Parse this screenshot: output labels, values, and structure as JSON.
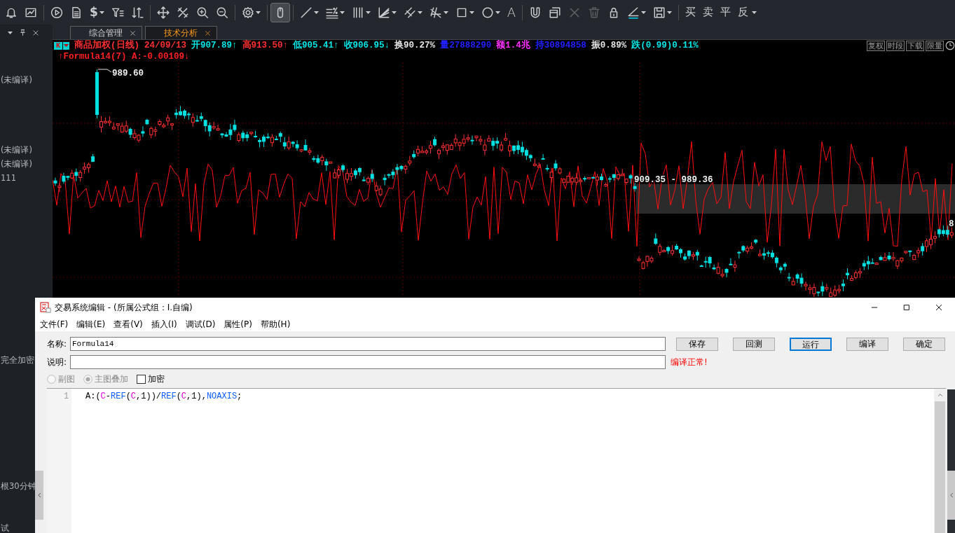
{
  "toolbar": {
    "tools": [
      {
        "selected": false,
        "dropdown": false,
        "disabled": false
      },
      {
        "selected": false,
        "dropdown": false,
        "disabled": false
      },
      {
        "selected": false,
        "dropdown": false,
        "disabled": false
      },
      {
        "selected": false,
        "dropdown": false,
        "disabled": false
      },
      {
        "glyph": "$",
        "selected": false,
        "dropdown": true,
        "disabled": false
      },
      {
        "selected": false,
        "dropdown": false,
        "disabled": false
      },
      {
        "selected": false,
        "dropdown": false,
        "disabled": false
      },
      {
        "selected": false,
        "dropdown": false,
        "disabled": false
      },
      {
        "selected": false,
        "dropdown": false,
        "disabled": false
      },
      {
        "selected": false,
        "dropdown": false,
        "disabled": false
      },
      {
        "selected": false,
        "dropdown": false,
        "disabled": false
      },
      {
        "selected": false,
        "dropdown": true,
        "disabled": false
      },
      {
        "selected": true,
        "dropdown": false,
        "disabled": false
      },
      {
        "selected": false,
        "dropdown": true,
        "disabled": false
      },
      {
        "selected": false,
        "dropdown": true,
        "disabled": false
      },
      {
        "selected": false,
        "dropdown": true,
        "disabled": false
      },
      {
        "selected": false,
        "dropdown": true,
        "disabled": false
      },
      {
        "selected": false,
        "dropdown": true,
        "disabled": false
      },
      {
        "selected": false,
        "dropdown": true,
        "disabled": false
      },
      {
        "selected": false,
        "dropdown": true,
        "disabled": false
      },
      {
        "selected": false,
        "dropdown": true,
        "disabled": false
      },
      {
        "glyph": "A",
        "selected": false,
        "dropdown": false,
        "disabled": false
      },
      {
        "selected": false,
        "dropdown": false,
        "disabled": false
      },
      {
        "selected": false,
        "dropdown": false,
        "disabled": false
      },
      {
        "selected": false,
        "dropdown": false,
        "disabled": true
      },
      {
        "selected": false,
        "dropdown": false,
        "disabled": true
      },
      {
        "selected": false,
        "dropdown": false,
        "disabled": false
      },
      {
        "selected": false,
        "dropdown": true,
        "disabled": false
      },
      {
        "selected": false,
        "dropdown": true,
        "disabled": false
      }
    ],
    "trade_buttons": [
      "买",
      "卖",
      "平",
      "反"
    ]
  },
  "left_panel": {
    "items": [
      "(未编译)",
      "(未编译)",
      "(未编译)",
      "111",
      "完全加密",
      "根30分钟",
      "试"
    ]
  },
  "tabs": [
    {
      "label": "综合管理",
      "selected": false
    },
    {
      "label": "技术分析",
      "selected": true
    }
  ],
  "chart": {
    "badge": "K",
    "quote": [
      {
        "text": "商品加权(日线)",
        "color": "#ff3030"
      },
      {
        "text": "24/09/13",
        "color": "#ff3030"
      },
      {
        "text": "开907.89↑",
        "color": "#00e5e5"
      },
      {
        "text": "高913.50↑",
        "color": "#ff3030"
      },
      {
        "text": "低905.41↑",
        "color": "#00e5e5"
      },
      {
        "text": "收906.95↓",
        "color": "#00e5e5"
      },
      {
        "text": "换90.27%",
        "color": "#e6e6e6"
      },
      {
        "text": "量27888290",
        "color": "#2020ff"
      },
      {
        "text": "额1.4兆",
        "color": "#ff30ff"
      },
      {
        "text": "持30894858",
        "color": "#2020ff"
      },
      {
        "text": "振0.89%",
        "color": "#e6e6e6"
      },
      {
        "text": "跌(0.99)0.11%",
        "color": "#00e5e5"
      }
    ],
    "indicator": "↑Formula14(7) A:-0.00109↓",
    "side_buttons": [
      "复权",
      "时段",
      "下载",
      "限量"
    ],
    "peak_label": "989.60",
    "range_label": "909.35 - 989.36",
    "edge_label": "8"
  },
  "dialog": {
    "title": "交易系统编辑 - (所属公式组：I.自编)",
    "menu": [
      "文件(F)",
      "编辑(E)",
      "查看(V)",
      "插入(I)",
      "调试(D)",
      "属性(P)",
      "帮助(H)"
    ],
    "name_label": "名称:",
    "name_value": "Formula14",
    "desc_label": "说明:",
    "buttons": [
      {
        "label": "保存",
        "focused": false
      },
      {
        "label": "回测",
        "focused": false
      },
      {
        "label": "运行",
        "focused": true
      },
      {
        "label": "编译",
        "focused": false
      },
      {
        "label": "确定",
        "focused": false
      }
    ],
    "status": "编译正常!",
    "options": [
      {
        "kind": "radio",
        "label": "副图",
        "selected": false,
        "disabled": true
      },
      {
        "kind": "radio",
        "label": "主图叠加",
        "selected": true,
        "disabled": true
      },
      {
        "kind": "checkbox",
        "label": "加密",
        "checked": false,
        "disabled": false
      }
    ],
    "line_number": "1",
    "code": [
      {
        "text": "A:(",
        "kind": "plain"
      },
      {
        "text": "C",
        "kind": "variable"
      },
      {
        "text": "-",
        "kind": "plain"
      },
      {
        "text": "REF",
        "kind": "function"
      },
      {
        "text": "(",
        "kind": "plain"
      },
      {
        "text": "C",
        "kind": "variable"
      },
      {
        "text": ",1))/",
        "kind": "plain"
      },
      {
        "text": "REF",
        "kind": "function"
      },
      {
        "text": "(",
        "kind": "plain"
      },
      {
        "text": "C",
        "kind": "variable"
      },
      {
        "text": ",1),",
        "kind": "plain"
      },
      {
        "text": "NOAXIS",
        "kind": "function"
      },
      {
        "text": ";",
        "kind": "plain"
      }
    ]
  }
}
